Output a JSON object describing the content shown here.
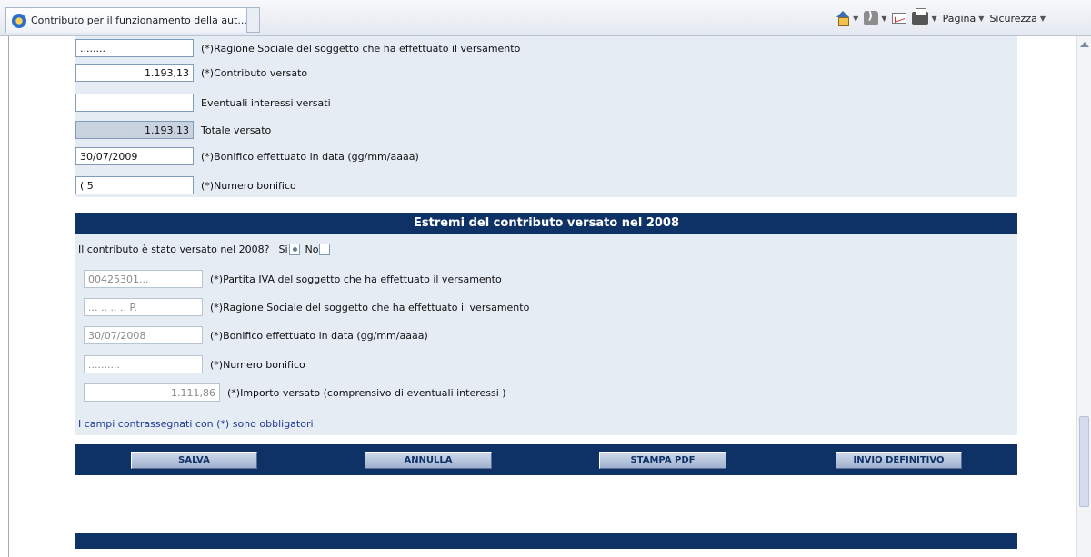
{
  "browser": {
    "tab_title": "Contributo per il funzionamento della aut...",
    "commands": {
      "page": "Pagina",
      "security": "Sicurezza"
    }
  },
  "section1": {
    "rows": [
      {
        "value": "........",
        "label": "(*)Ragione Sociale del soggetto che ha effettuato il versamento"
      },
      {
        "value": "1.193,13",
        "label": "(*)Contributo versato"
      },
      {
        "value": "",
        "label": "Eventuali interessi versati"
      },
      {
        "value": "1.193,13",
        "label": "Totale versato"
      },
      {
        "value": "30/07/2009",
        "label": "(*)Bonifico effettuato in data (gg/mm/aaaa)"
      },
      {
        "value": "(        5",
        "label": "(*)Numero bonifico"
      }
    ]
  },
  "section2": {
    "header": "Estremi del contributo versato nel 2008",
    "question": "Il contributo è stato versato nel 2008?",
    "yes_label": "Si",
    "no_label": "No",
    "rows": [
      {
        "value": "00425301...",
        "label": "(*)Partita IVA del soggetto che ha effettuato il versamento"
      },
      {
        "value": "...      .. .. .. P.",
        "label": "(*)Ragione Sociale del soggetto che ha effettuato il versamento"
      },
      {
        "value": "30/07/2008",
        "label": "(*)Bonifico effettuato in data (gg/mm/aaaa)"
      },
      {
        "value": "..........",
        "label": "(*)Numero bonifico"
      },
      {
        "value": "1.111,86",
        "label": "(*)Importo versato (comprensivo di eventuali interessi )"
      }
    ],
    "note": "I campi contrassegnati con (*) sono obbligatori"
  },
  "buttons": {
    "save": "SALVA",
    "cancel": "ANNULLA",
    "print_pdf": "STAMPA PDF",
    "final_send": "INVIO DEFINITIVO"
  },
  "colors": {
    "header_bg": "#0f3266",
    "panel_bg": "#e6ecf4",
    "note_text": "#1d3b94"
  }
}
